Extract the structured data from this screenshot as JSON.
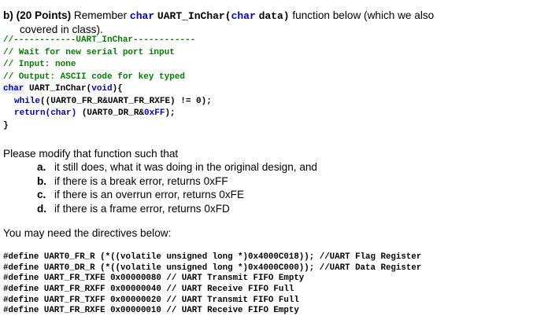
{
  "question": {
    "label": "b)",
    "points": "(20 Points)",
    "intro_1": "Remember",
    "func_name_1": "char",
    "func_name_2": "UART_InChar",
    "func_paren_open": "(",
    "func_arg_type": "char",
    "func_arg_name": "data)",
    "intro_2": "function below (which we also",
    "intro_3": "covered in class)."
  },
  "code": {
    "line1": "//------------UART_InChar------------",
    "line2": "// Wait for new serial port input",
    "line3": "// Input: none",
    "line4": "// Output: ASCII code for key typed",
    "line5_kw": "char",
    "line5_name": " UART_InChar(",
    "line5_void": "void",
    "line5_end": "){",
    "line6_kw": "while",
    "line6_rest": "((UART0_FR_R&UART_FR_RXFE) != 0);",
    "line7_kw": "return",
    "line7_cast": "(char)",
    "line7_rest": " (UART0_DR_R&",
    "line7_hex": "0xFF",
    "line7_end": ");",
    "line8": "}"
  },
  "modify": {
    "intro": "Please modify that function such that",
    "items": [
      {
        "label": "a.",
        "text": "it still does, what it was doing in the original design, and"
      },
      {
        "label": "b.",
        "text": "if there is a break error, returns 0xFF"
      },
      {
        "label": "c.",
        "text": "if there is an overrun error, returns 0xFE"
      },
      {
        "label": "d.",
        "text": "if there is a frame error, returns 0xFD"
      }
    ]
  },
  "directives": {
    "intro": "You may need the directives below:",
    "lines": [
      "#define UART0_FR_R (*((volatile unsigned long *)0x4000C018)); //UART Flag Register",
      "#define UART0_DR_R (*((volatile unsigned long *)0x4000C000)); //UART Data Register",
      "#define UART_FR_TXFE 0x00000080 // UART Transmit FIFO Empty",
      "#define UART_FR_RXFF 0x00000040 // UART Receive FIFO Full",
      "#define UART_FR_TXFF 0x00000020 // UART Transmit FIFO Full",
      "#define UART_FR_RXFE 0x00000010 // UART Receive FIFO Empty"
    ]
  }
}
